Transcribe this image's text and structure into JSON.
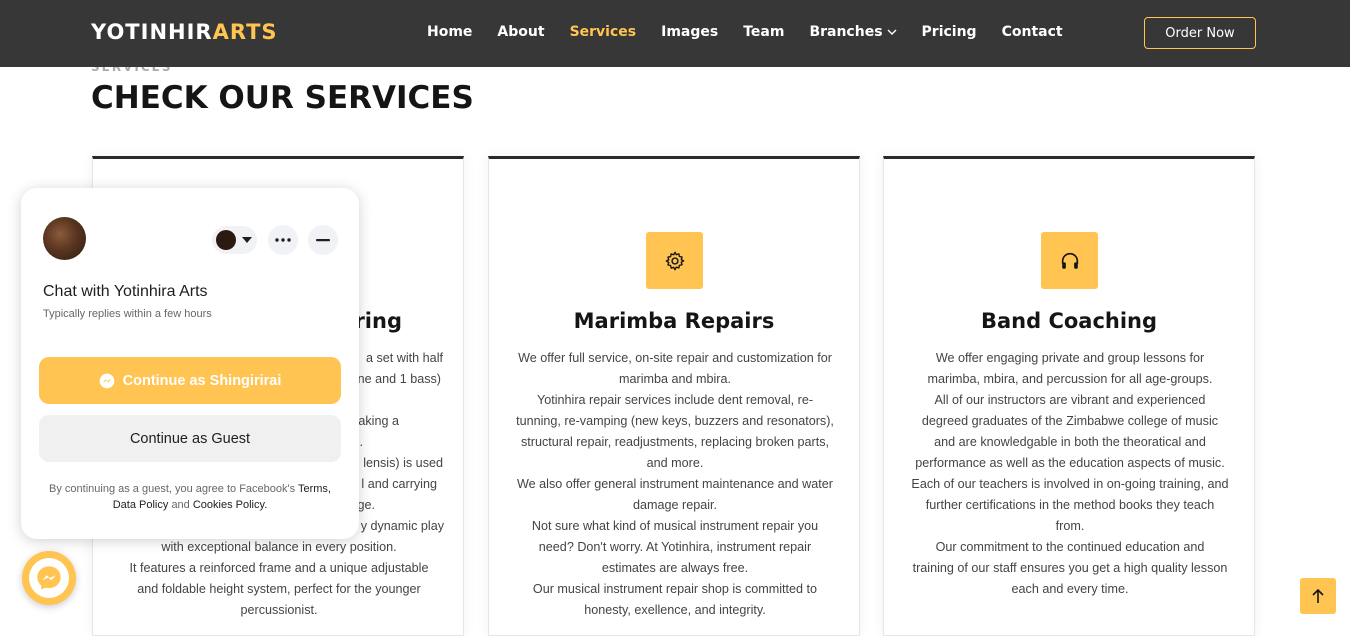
{
  "header": {
    "logo_main": "YOTINHIR",
    "logo_accent": "ARTS",
    "nav": {
      "home": "Home",
      "about": "About",
      "services": "Services",
      "images": "Images",
      "team": "Team",
      "branches": "Branches",
      "pricing": "Pricing",
      "contact": "Contact"
    },
    "order_label": "Order Now"
  },
  "section": {
    "subtitle": "Services",
    "title": "CHECK OUR SERVICES"
  },
  "cards": {
    "c1": {
      "title_fragment": "uring",
      "lines": [
        "a set with half",
        "ne and 1 bass)",
        "",
        "Making a",
        "6).",
        "lensis) is used",
        "l and carrying",
        "nge.",
        "y dynamic play",
        "with exceptional balance in every position.",
        "It features a reinforced frame and a unique adjustable",
        "and foldable height system, perfect for the younger",
        "percussionist."
      ]
    },
    "c2": {
      "title": "Marimba Repairs",
      "icon": "gear-icon",
      "lines": [
        "We offer full service, on-site repair and customization for",
        "marimba and mbira.",
        "Yotinhira repair services include dent removal, re-",
        "tunning, re-vamping (new keys, buzzers and resonators),",
        "structural repair, readjustments, replacing broken parts,",
        "and more.",
        "We also offer general instrument maintenance and water",
        "damage repair.",
        "Not sure what kind of musical instrument repair you",
        "need? Don't worry. At Yotinhira, instrument repair",
        "estimates are always free.",
        "Our musical instrument repair shop is committed to",
        "honesty, exellence, and integrity."
      ]
    },
    "c3": {
      "title": "Band Coaching",
      "icon": "headphones-icon",
      "lines": [
        "We offer engaging private and group lessons for",
        "marimba, mbira, and percussion for all age-groups.",
        "All of our instructors are vibrant and experienced",
        "degreed graduates of the Zimbabwe college of music",
        "and are knowledgable in both the theoratical and",
        "performance as well as the education aspects of music.",
        "Each of our teachers is involved in on-going training, and",
        "further certifications in the method books they teach",
        "from.",
        "Our commitment to the continued education and",
        "training of our staff ensures you get a high quality lesson",
        "each and every time."
      ]
    }
  },
  "chat": {
    "title": "Chat with Yotinhira Arts",
    "subtitle": "Typically replies within a few hours",
    "primary_label": "Continue as Shingirirai",
    "secondary_label": "Continue as Guest",
    "legal_prefix": "By continuing as a guest, you agree to Facebook's",
    "terms": "Terms",
    "data_policy": "Data Policy",
    "and": "and",
    "cookies_policy": "Cookies Policy"
  },
  "colors": {
    "accent": "#ffc451",
    "header_bg": "#373737",
    "title": "#151515"
  }
}
